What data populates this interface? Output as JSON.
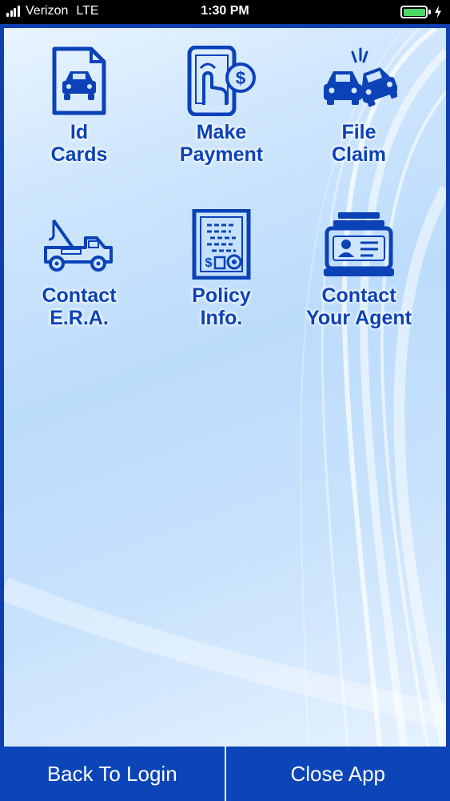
{
  "status_bar": {
    "carrier": "Verizon",
    "network": "LTE",
    "time": "1:30 PM",
    "battery_level": 1.0
  },
  "tiles": [
    {
      "label": "Id\nCards",
      "icon": "id-card-car-icon"
    },
    {
      "label": "Make\nPayment",
      "icon": "mobile-payment-icon"
    },
    {
      "label": "File\nClaim",
      "icon": "car-collision-icon"
    },
    {
      "label": "Contact\nE.R.A.",
      "icon": "tow-truck-icon"
    },
    {
      "label": "Policy\nInfo.",
      "icon": "policy-document-icon"
    },
    {
      "label": "Contact\nYour Agent",
      "icon": "agent-contact-card-icon"
    }
  ],
  "bottom_bar": {
    "back_label": "Back To Login",
    "close_label": "Close App"
  },
  "colors": {
    "icon_blue": "#0b42b8",
    "bar_blue": "#0b45b8",
    "battery_green": "#4cd964"
  }
}
